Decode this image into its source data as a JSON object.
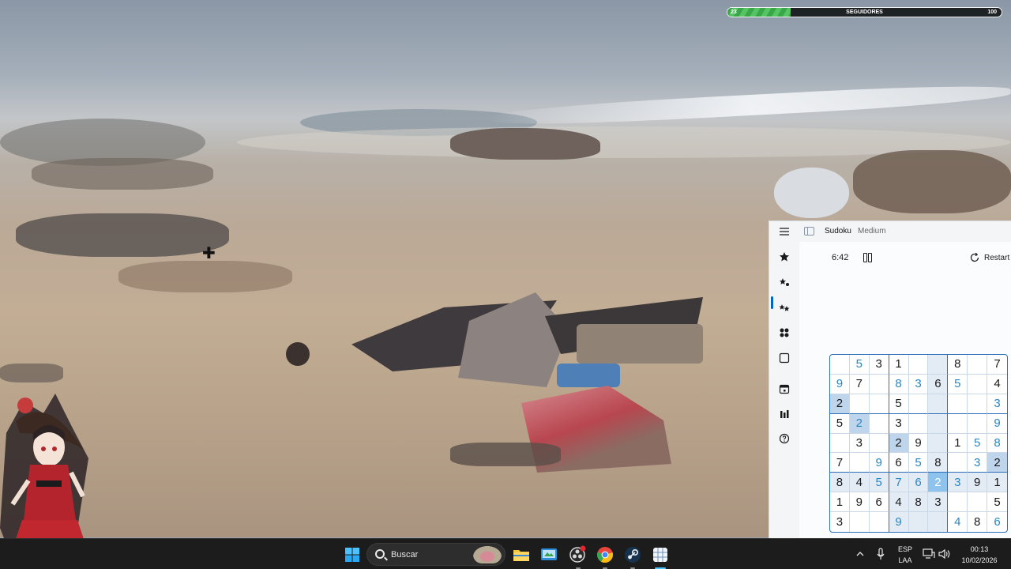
{
  "overlay": {
    "follower_goal": {
      "current": "23",
      "label": "SEGUIDORES",
      "target": "100",
      "progress": 0.23,
      "color": "#4cb85a"
    }
  },
  "sudoku": {
    "app_title": "Sudoku",
    "difficulty": "Medium",
    "timer": "6:42",
    "restart_label": "Restart",
    "nav_icons": [
      "hamburger-menu-icon",
      "star-icon",
      "sparkle-star-icon",
      "two-stars-icon",
      "four-stars-icon",
      "blank-square-icon",
      "calendar-icon",
      "bar-chart-icon",
      "help-icon"
    ],
    "accent_color": "#0067c0",
    "user_digit_color": "#2a86c2",
    "grid": [
      [
        "",
        "5",
        "3",
        "1",
        "",
        "",
        "8",
        "",
        "7"
      ],
      [
        "9",
        "7",
        "",
        "8",
        "3",
        "6",
        "5",
        "",
        "4"
      ],
      [
        "2",
        "",
        "",
        "5",
        "",
        "",
        "",
        "",
        "3"
      ],
      [
        "5",
        "2",
        "",
        "3",
        "",
        "",
        "",
        "",
        "9"
      ],
      [
        "",
        "3",
        "",
        "2",
        "9",
        "",
        "1",
        "5",
        "8"
      ],
      [
        "7",
        "",
        "9",
        "6",
        "5",
        "8",
        "",
        "3",
        "2"
      ],
      [
        "8",
        "4",
        "5",
        "7",
        "6",
        "2",
        "3",
        "9",
        "1"
      ],
      [
        "1",
        "9",
        "6",
        "4",
        "8",
        "3",
        "",
        "",
        "5"
      ],
      [
        "3",
        "",
        "",
        "9",
        "",
        "",
        "4",
        "8",
        "6"
      ]
    ],
    "user_entries": [
      [
        0,
        1
      ],
      [
        1,
        0
      ],
      [
        1,
        3
      ],
      [
        1,
        4
      ],
      [
        1,
        6
      ],
      [
        2,
        8
      ],
      [
        3,
        1
      ],
      [
        3,
        8
      ],
      [
        4,
        7
      ],
      [
        4,
        8
      ],
      [
        5,
        2
      ],
      [
        5,
        4
      ],
      [
        5,
        7
      ],
      [
        6,
        2
      ],
      [
        6,
        3
      ],
      [
        6,
        4
      ],
      [
        6,
        5
      ],
      [
        6,
        6
      ],
      [
        8,
        3
      ],
      [
        8,
        6
      ],
      [
        8,
        8
      ]
    ],
    "selected_cell": [
      6,
      5
    ]
  },
  "taskbar": {
    "search_label": "Buscar",
    "language_line1": "ESP",
    "language_line2": "LAA",
    "time": "00:13",
    "date": "10/02/2026",
    "pinned_apps": [
      "windows-start-icon",
      "file-explorer-icon",
      "control-panel-icon",
      "obs-recorder-icon",
      "chrome-icon",
      "steam-icon",
      "sudoku-app-icon"
    ]
  }
}
